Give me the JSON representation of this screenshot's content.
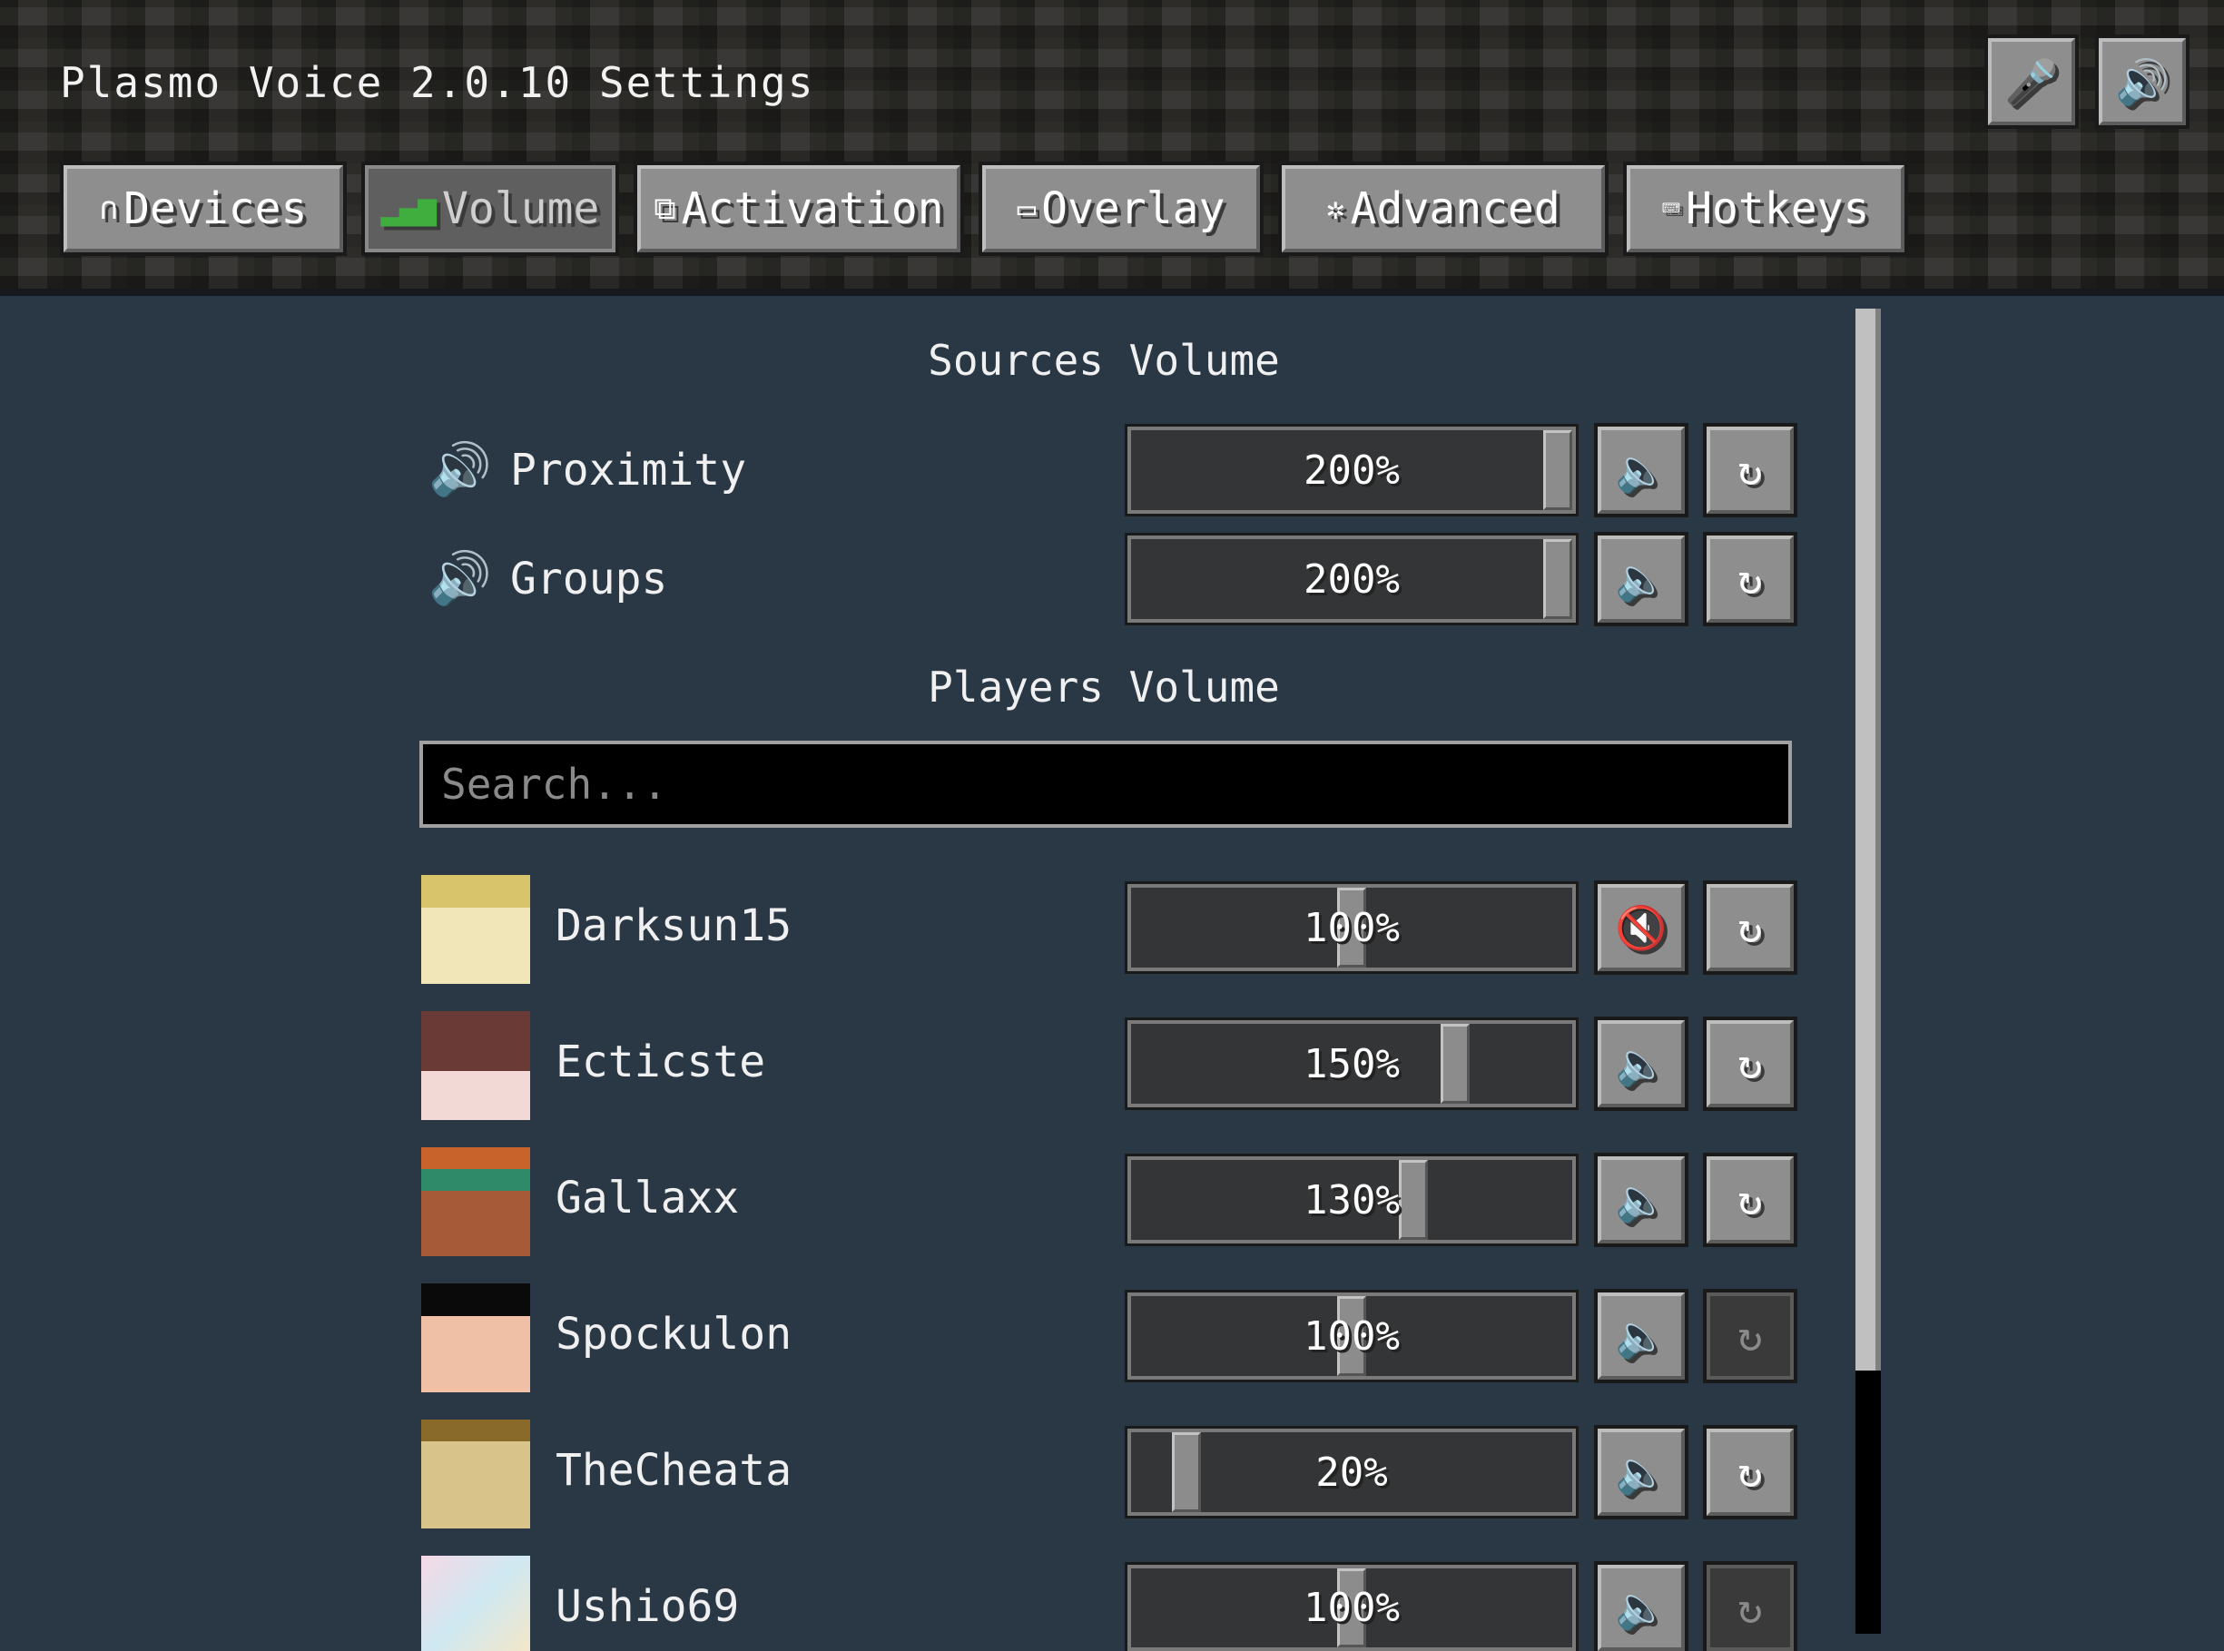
{
  "title": "Plasmo Voice 2.0.10 Settings",
  "header_buttons": [
    {
      "name": "microphone-icon",
      "glyph": "🎤"
    },
    {
      "name": "speaker-icon",
      "glyph": "🔊"
    }
  ],
  "tabs": [
    {
      "label": "Devices",
      "icon": "headphones-icon",
      "glyph": "∩",
      "active": false
    },
    {
      "label": "Volume",
      "icon": "volume-bars-icon",
      "glyph": "▮",
      "active": true
    },
    {
      "label": "Activation",
      "icon": "activation-icon",
      "glyph": "⧉",
      "active": false
    },
    {
      "label": "Overlay",
      "icon": "monitor-icon",
      "glyph": "▭",
      "active": false
    },
    {
      "label": "Advanced",
      "icon": "gear-icon",
      "glyph": "✲",
      "active": false
    },
    {
      "label": "Hotkeys",
      "icon": "keyboard-icon",
      "glyph": "⌨",
      "active": false
    }
  ],
  "sources_volume": {
    "title": "Sources Volume",
    "rows": [
      {
        "label": "Proximity",
        "value": "200%",
        "level": 1.0,
        "muted": false
      },
      {
        "label": "Groups",
        "value": "200%",
        "level": 1.0,
        "muted": false
      }
    ]
  },
  "players_volume": {
    "title": "Players Volume",
    "search_placeholder": "Search...",
    "rows": [
      {
        "name": "Darksun15",
        "value": "100%",
        "level": 0.5,
        "muted": true,
        "reset_enabled": true
      },
      {
        "name": "Ecticste",
        "value": "150%",
        "level": 0.75,
        "muted": false,
        "reset_enabled": true
      },
      {
        "name": "Gallaxx",
        "value": "130%",
        "level": 0.65,
        "muted": false,
        "reset_enabled": true
      },
      {
        "name": "Spockulon",
        "value": "100%",
        "level": 0.5,
        "muted": false,
        "reset_enabled": false
      },
      {
        "name": "TheCheata",
        "value": "20%",
        "level": 0.1,
        "muted": false,
        "reset_enabled": true
      },
      {
        "name": "Ushio69",
        "value": "100%",
        "level": 0.5,
        "muted": false,
        "reset_enabled": false
      }
    ]
  },
  "colors": {
    "background": "#2a3846",
    "button": "#8e8e8e",
    "mute_slash": "#c0392b"
  }
}
